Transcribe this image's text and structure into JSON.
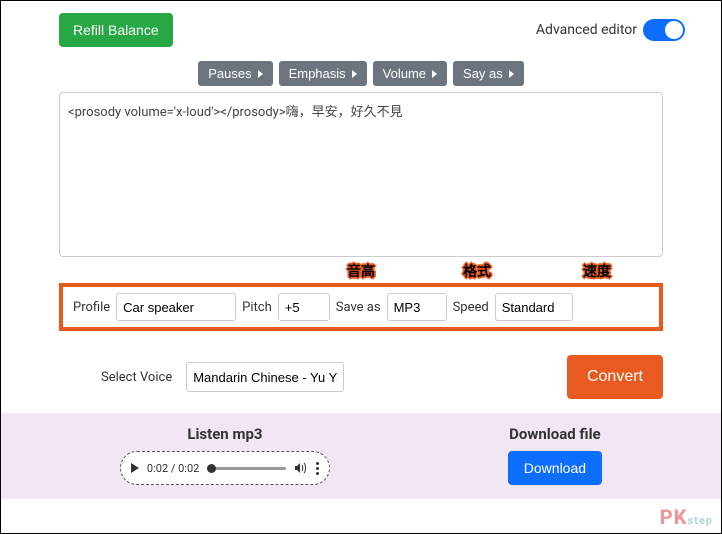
{
  "refill_label": "Refill Balance",
  "adv_editor_label": "Advanced editor",
  "ssml": {
    "pauses": "Pauses",
    "emphasis": "Emphasis",
    "volume": "Volume",
    "sayas": "Say as"
  },
  "text_value": "<prosody volume='x-loud'></prosody>嗨，早安，好久不見",
  "annotations": {
    "pitch": "音高",
    "format": "格式",
    "speed": "速度"
  },
  "settings": {
    "profile_label": "Profile",
    "profile_value": "Car speaker",
    "pitch_label": "Pitch",
    "pitch_value": "+5",
    "saveas_label": "Save as",
    "saveas_value": "MP3",
    "speed_label": "Speed",
    "speed_value": "Standard"
  },
  "voice": {
    "label": "Select Voice",
    "value": "Mandarin Chinese - Yu Ya"
  },
  "convert_label": "Convert",
  "listen": {
    "title": "Listen mp3",
    "time": "0:02 / 0:02"
  },
  "download": {
    "title": "Download file",
    "button": "Download"
  },
  "watermark": {
    "pk": "PK",
    "rest": "step"
  }
}
